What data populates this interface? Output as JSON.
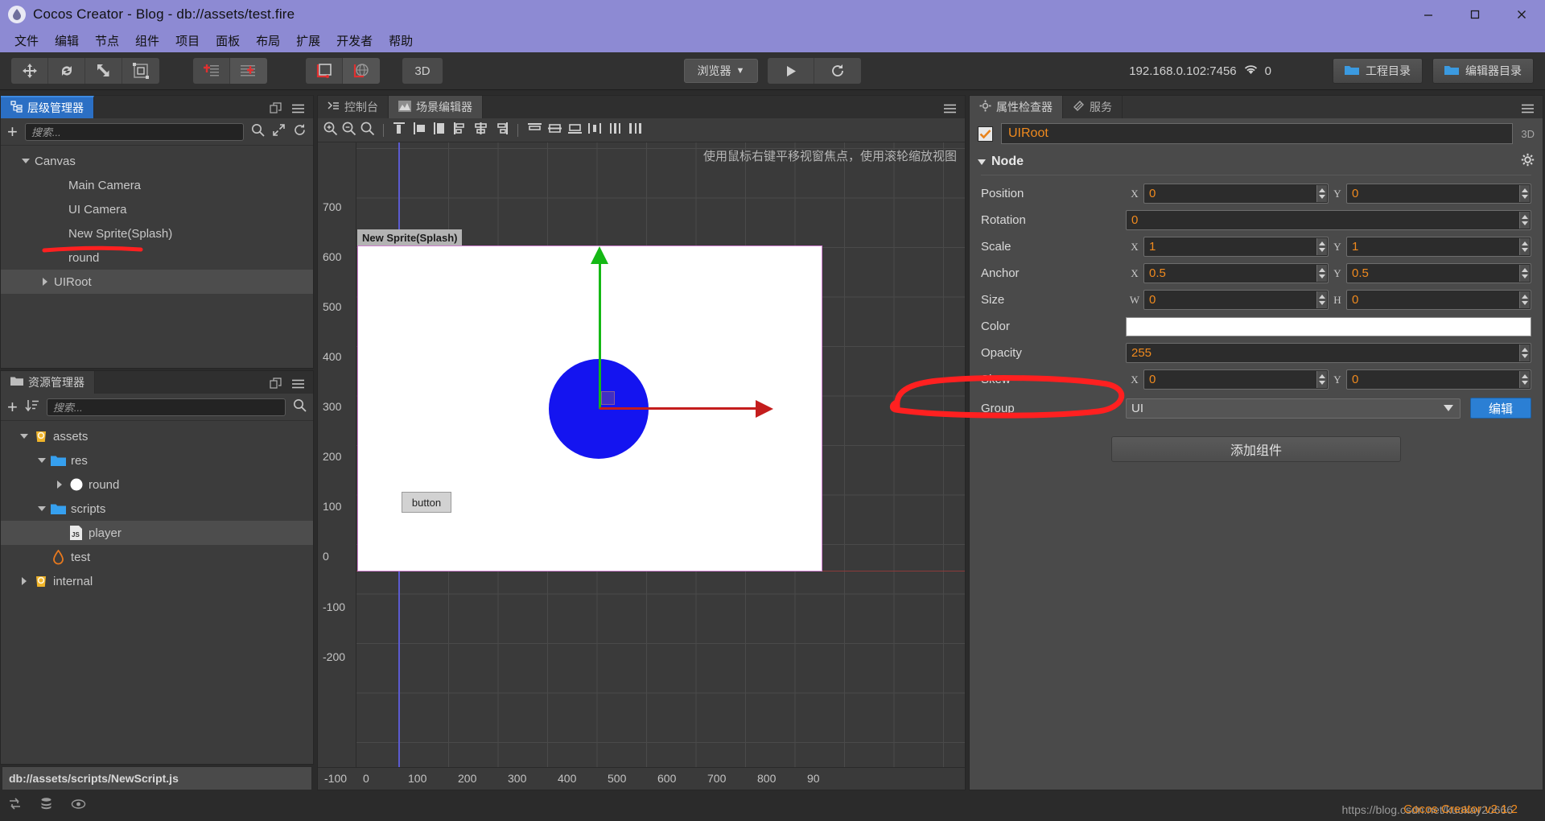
{
  "titlebar": {
    "title": "Cocos Creator - Blog - db://assets/test.fire",
    "minimize": "minimize-icon",
    "maximize": "maximize-icon",
    "close": "close-icon"
  },
  "menubar": {
    "items": [
      {
        "label": "文件"
      },
      {
        "label": "编辑"
      },
      {
        "label": "节点"
      },
      {
        "label": "组件"
      },
      {
        "label": "项目"
      },
      {
        "label": "面板"
      },
      {
        "label": "布局"
      },
      {
        "label": "扩展"
      },
      {
        "label": "开发者"
      },
      {
        "label": "帮助"
      }
    ]
  },
  "toolbar": {
    "transform_tools": [
      "move-icon",
      "rotate-icon",
      "scale-icon",
      "rect-transform-icon"
    ],
    "pivot_tools": [
      "pivot-local-icon",
      "pivot-center-icon"
    ],
    "coord_tools": [
      "coord-local-icon",
      "coord-global-icon"
    ],
    "mode_3d_label": "3D",
    "preview_target": "浏览器",
    "play_label": "play-icon",
    "refresh_label": "refresh-icon",
    "ip_address": "192.168.0.102:7456",
    "wifi_icon": "wifi-icon",
    "device_count": "0",
    "project_dir_label": "工程目录",
    "editor_dir_label": "编辑器目录"
  },
  "hierarchy": {
    "tab_label": "层级管理器",
    "tab_icon": "hierarchy-icon",
    "search_placeholder": "搜索...",
    "add_label": "+",
    "tools": [
      "search-icon",
      "expand-icon",
      "refresh-icon"
    ],
    "nodes": [
      {
        "label": "Canvas",
        "depth": 0,
        "arrow": "down",
        "selected": false
      },
      {
        "label": "Main Camera",
        "depth": 1,
        "arrow": "none",
        "selected": false
      },
      {
        "label": "UI Camera",
        "depth": 1,
        "arrow": "none",
        "selected": false
      },
      {
        "label": "New Sprite(Splash)",
        "depth": 1,
        "arrow": "none",
        "selected": false
      },
      {
        "label": "round",
        "depth": 1,
        "arrow": "none",
        "selected": false
      },
      {
        "label": "UIRoot",
        "depth": 1,
        "arrow": "right",
        "selected": true
      }
    ]
  },
  "assets": {
    "tab_label": "资源管理器",
    "tab_icon": "folder-icon",
    "search_placeholder": "搜索...",
    "add_label": "+",
    "sort_icon": "sort-icon",
    "search_icon": "search-icon",
    "nodes": [
      {
        "label": "assets",
        "depth": 0,
        "arrow": "down",
        "icon": "db-icon",
        "selected": false
      },
      {
        "label": "res",
        "depth": 1,
        "arrow": "down",
        "icon": "folder-icon",
        "selected": false
      },
      {
        "label": "round",
        "depth": 2,
        "arrow": "right",
        "icon": "circle-icon",
        "selected": false
      },
      {
        "label": "scripts",
        "depth": 1,
        "arrow": "down",
        "icon": "folder-icon",
        "selected": false
      },
      {
        "label": "player",
        "depth": 2,
        "arrow": "none",
        "icon": "js-icon",
        "selected": true
      },
      {
        "label": "test",
        "depth": 1,
        "arrow": "none",
        "icon": "fire-icon",
        "selected": false
      },
      {
        "label": "internal",
        "depth": 0,
        "arrow": "right",
        "icon": "db-icon",
        "selected": false
      }
    ],
    "status_path": "db://assets/scripts/NewScript.js",
    "status_icons": [
      "sync-icon",
      "database-icon",
      "eye-icon"
    ]
  },
  "scene": {
    "tabs": [
      {
        "label": "控制台",
        "icon": "console-icon",
        "active": false
      },
      {
        "label": "场景编辑器",
        "icon": "scene-icon",
        "active": true
      }
    ],
    "menu_icon": "hamburger-icon",
    "align_tools": [
      "zoom-in-icon",
      "zoom-out-icon",
      "zoom-fit-icon",
      "align-left-icon",
      "align-center-h-icon",
      "align-right-icon",
      "align-left-edge-icon",
      "align-center-icon",
      "align-right-edge-icon",
      "align-top-icon",
      "align-middle-icon",
      "align-bottom-icon",
      "distribute-h-icon",
      "distribute-v-icon",
      "distribute-edge-icon"
    ],
    "hint": "使用鼠标右键平移视窗焦点，使用滚轮缩放视图",
    "sprite_label": "New Sprite(Splash)",
    "button_node_label": "button",
    "ruler_y": [
      "700",
      "600",
      "500",
      "400",
      "300",
      "200",
      "100",
      "0",
      "-100",
      "-200"
    ],
    "ruler_x": [
      "-100",
      "0",
      "100",
      "200",
      "300",
      "400",
      "500",
      "600",
      "700",
      "800",
      "90"
    ],
    "gizmo": {
      "x_axis_color": "#c41d1d",
      "y_axis_color": "#15b815",
      "circle_color": "#1414f0"
    }
  },
  "inspector": {
    "tabs": [
      {
        "label": "属性检查器",
        "icon": "gear-icon",
        "active": true
      },
      {
        "label": "服务",
        "icon": "service-icon",
        "active": false
      }
    ],
    "menu_icon": "hamburger-icon",
    "node_enabled": true,
    "node_name": "UIRoot",
    "mode_3d_label": "3D",
    "section_title": "Node",
    "section_gear": "gear-icon",
    "properties": [
      {
        "label": "Position",
        "type": "xy",
        "x_label": "X",
        "y_label": "Y",
        "x": "0",
        "y": "0"
      },
      {
        "label": "Rotation",
        "type": "single",
        "value": "0"
      },
      {
        "label": "Scale",
        "type": "xy",
        "x_label": "X",
        "y_label": "Y",
        "x": "1",
        "y": "1"
      },
      {
        "label": "Anchor",
        "type": "xy",
        "x_label": "X",
        "y_label": "Y",
        "x": "0.5",
        "y": "0.5"
      },
      {
        "label": "Size",
        "type": "xy",
        "x_label": "W",
        "y_label": "H",
        "x": "0",
        "y": "0"
      },
      {
        "label": "Color",
        "type": "color",
        "value": "#ffffff"
      },
      {
        "label": "Opacity",
        "type": "single",
        "value": "255"
      },
      {
        "label": "Skew",
        "type": "xy",
        "x_label": "X",
        "y_label": "Y",
        "x": "0",
        "y": "0"
      },
      {
        "label": "Group",
        "type": "dropdown",
        "value": "UI",
        "button_label": "编辑"
      }
    ],
    "add_component_label": "添加组件",
    "accent_value_color": "#f08a1e",
    "edit_button_color": "#2b7fd4"
  },
  "watermark": {
    "url": "https://blog.csdn.net/kuokay2o666",
    "version": "Cocos Creator v2.1.2"
  },
  "annotations": {
    "underline_color": "#ff2020",
    "circle_color": "#ff2020"
  }
}
